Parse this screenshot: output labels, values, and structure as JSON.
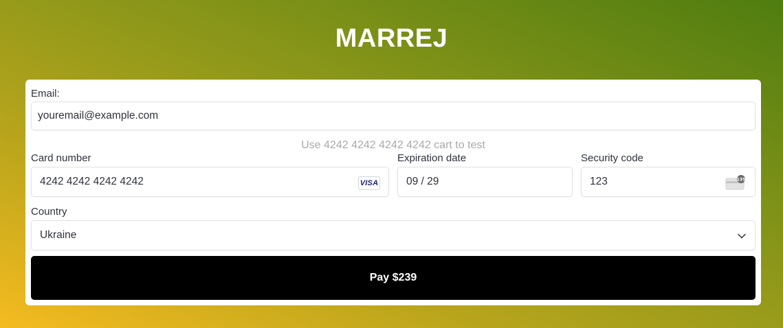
{
  "brand": {
    "title": "MARREJ"
  },
  "form": {
    "email": {
      "label": "Email:",
      "value": "youremail@example.com"
    },
    "test_hint": "Use 4242 4242 4242 4242 cart to test",
    "card_number": {
      "label": "Card number",
      "value": "4242 4242 4242 4242",
      "brand_badge": "VISA",
      "icon": "visa-card-icon"
    },
    "expiration": {
      "label": "Expiration date",
      "value": "09 / 29"
    },
    "security_code": {
      "label": "Security code",
      "value": "123",
      "icon": "cvc-card-icon",
      "icon_badge": "135"
    },
    "country": {
      "label": "Country",
      "selected": "Ukraine",
      "icon": "chevron-down-icon"
    },
    "pay_button": {
      "label": "Pay $239"
    }
  },
  "colors": {
    "gradient_start": "#f5bb20",
    "gradient_end": "#4f7d10",
    "button_bg": "#000000",
    "hint_text": "#a9a9a9",
    "visa_blue": "#1a1f71"
  }
}
